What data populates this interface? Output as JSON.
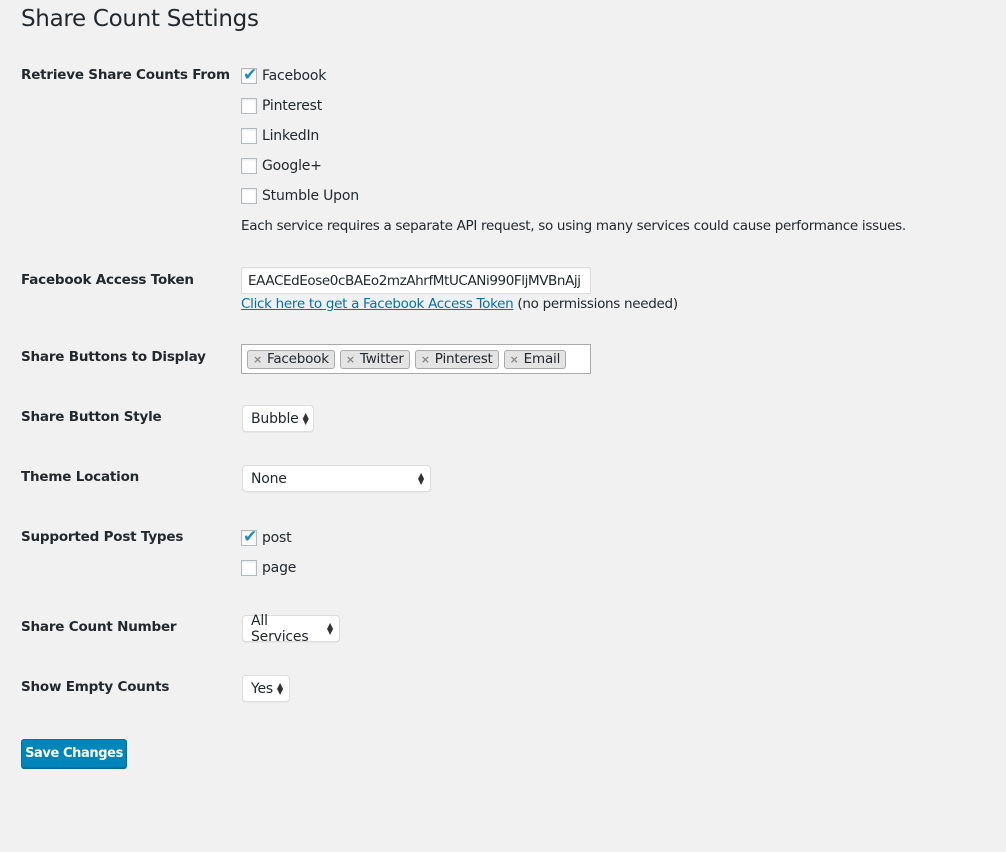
{
  "page": {
    "title": "Share Count Settings"
  },
  "retrieve": {
    "label": "Retrieve Share Counts From",
    "options": [
      {
        "label": "Facebook",
        "checked": true
      },
      {
        "label": "Pinterest",
        "checked": false
      },
      {
        "label": "LinkedIn",
        "checked": false
      },
      {
        "label": "Google+",
        "checked": false
      },
      {
        "label": "Stumble Upon",
        "checked": false
      }
    ],
    "description": "Each service requires a separate API request, so using many services could cause performance issues."
  },
  "access_token": {
    "label": "Facebook Access Token",
    "value": "EAACEdEose0cBAEo2mzAhrfMtUCANi990FljMVBnAjj",
    "link_text": "Click here to get a Facebook Access Token",
    "link_note": "(no permissions needed)"
  },
  "share_buttons": {
    "label": "Share Buttons to Display",
    "remove_glyph": "×",
    "tags": [
      "Facebook",
      "Twitter",
      "Pinterest",
      "Email"
    ]
  },
  "button_style": {
    "label": "Share Button Style",
    "value": "Bubble"
  },
  "theme_location": {
    "label": "Theme Location",
    "value": "None"
  },
  "post_types": {
    "label": "Supported Post Types",
    "options": [
      {
        "label": "post",
        "checked": true
      },
      {
        "label": "page",
        "checked": false
      }
    ]
  },
  "count_number": {
    "label": "Share Count Number",
    "value": "All Services"
  },
  "empty_counts": {
    "label": "Show Empty Counts",
    "value": "Yes"
  },
  "icons": {
    "check": "✔",
    "select_up": "▲",
    "select_down": "▼"
  },
  "save_label": "Save Changes",
  "colors": {
    "accent": "#0085ba",
    "link": "#0073aa",
    "check": "#1e8cbe",
    "background": "#f1f1f1"
  }
}
